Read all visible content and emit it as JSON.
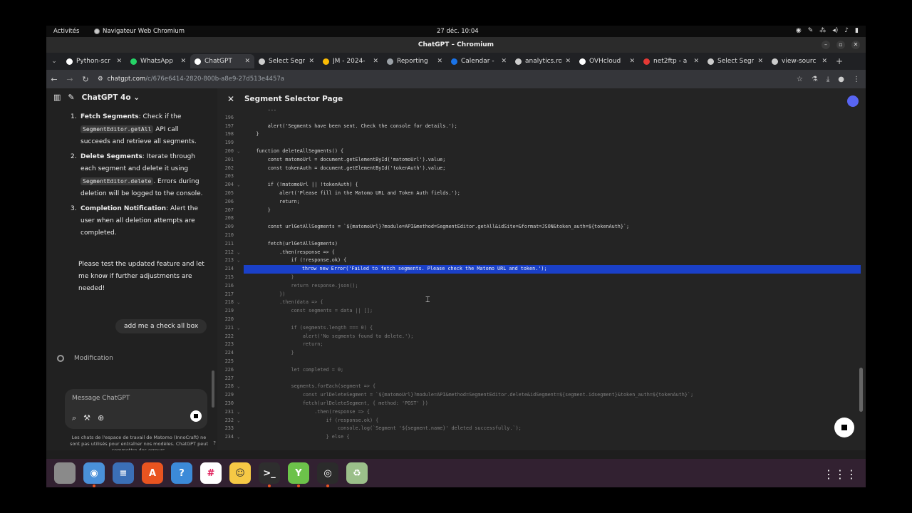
{
  "topbar": {
    "activities": "Activités",
    "app_name": "Navigateur Web Chromium",
    "clock": "27 déc.  10:04"
  },
  "window": {
    "title": "ChatGPT – Chromium"
  },
  "tabs": [
    {
      "label": "Python-scr",
      "color": "#ffffff"
    },
    {
      "label": "WhatsApp",
      "color": "#25d366"
    },
    {
      "label": "ChatGPT",
      "color": "#ffffff",
      "active": true
    },
    {
      "label": "Select Segn",
      "color": "#cccccc"
    },
    {
      "label": "JM - 2024-",
      "color": "#fbbc04"
    },
    {
      "label": "Reporting",
      "color": "#9aa0a6"
    },
    {
      "label": "Calendar - ",
      "color": "#1a73e8"
    },
    {
      "label": "analytics.ro",
      "color": "#cccccc"
    },
    {
      "label": "OVHcloud",
      "color": "#ffffff"
    },
    {
      "label": "net2ftp - a",
      "color": "#e53935"
    },
    {
      "label": "Select Segn",
      "color": "#cccccc"
    },
    {
      "label": "view-sourc",
      "color": "#cccccc"
    }
  ],
  "address": {
    "host": "chatgpt.com",
    "path": "/c/676e6414-2820-800b-a8e9-27d513e4457a"
  },
  "chat": {
    "model": "ChatGPT 4o",
    "steps": [
      {
        "num": "1.",
        "title": "Fetch Segments",
        "pre": ": Check if the ",
        "code": "SegmentEditor.getAll",
        "post": " API call succeeds and retrieve all segments."
      },
      {
        "num": "2.",
        "title": "Delete Segments",
        "pre": ": Iterate through each segment and delete it using ",
        "code": "SegmentEditor.delete",
        "post": ". Errors during deletion will be logged to the console."
      },
      {
        "num": "3.",
        "title": "Completion Notification",
        "pre": ": Alert the user when all deletion attempts are completed.",
        "code": "",
        "post": ""
      }
    ],
    "closing": "Please test the updated feature and let me know if further adjustments are needed!",
    "user_message": "add me a check all box",
    "status": "Modification",
    "composer_placeholder": "Message ChatGPT",
    "disclaimer": "Les chats de l'espace de travail de Matomo (InnoCraft) ne sont pas utilisés pour entraîner nos modèles. ChatGPT peut commettre des erreurs.",
    "help": "?"
  },
  "canvas": {
    "title": "Segment Selector Page",
    "highlight_line": "214",
    "lines": [
      {
        "n": "",
        "t": "        ..."
      },
      {
        "n": "196",
        "t": ""
      },
      {
        "n": "197",
        "t": "        alert('Segments have been sent. Check the console for details.');"
      },
      {
        "n": "198",
        "t": "    }"
      },
      {
        "n": "199",
        "t": ""
      },
      {
        "n": "200",
        "t": "    function deleteAllSegments() {",
        "fold": true
      },
      {
        "n": "201",
        "t": "        const matomoUrl = document.getElementById('matomoUrl').value;"
      },
      {
        "n": "202",
        "t": "        const tokenAuth = document.getElementById('tokenAuth').value;"
      },
      {
        "n": "203",
        "t": ""
      },
      {
        "n": "204",
        "t": "        if (!matomoUrl || !tokenAuth) {",
        "fold": true
      },
      {
        "n": "205",
        "t": "            alert('Please fill in the Matomo URL and Token Auth fields.');"
      },
      {
        "n": "206",
        "t": "            return;"
      },
      {
        "n": "207",
        "t": "        }"
      },
      {
        "n": "208",
        "t": ""
      },
      {
        "n": "209",
        "t": "        const urlGetAllSegments = `${matomoUrl}?module=API&method=SegmentEditor.getAll&idSite=&format=JSON&token_auth=${tokenAuth}`;"
      },
      {
        "n": "210",
        "t": ""
      },
      {
        "n": "211",
        "t": "        fetch(urlGetAllSegments)"
      },
      {
        "n": "212",
        "t": "            .then(response => {",
        "fold": true
      },
      {
        "n": "213",
        "t": "                if (!response.ok) {",
        "fold": true
      },
      {
        "n": "214",
        "t": "                    throw new Error('Failed to fetch segments. Please check the Matomo URL and token.');"
      },
      {
        "n": "215",
        "t": "                }",
        "dim": true
      },
      {
        "n": "216",
        "t": "                return response.json();",
        "dim": true
      },
      {
        "n": "217",
        "t": "            })",
        "dim": true
      },
      {
        "n": "218",
        "t": "            .then(data => {",
        "fold": true,
        "dim": true
      },
      {
        "n": "219",
        "t": "                const segments = data || [];",
        "dim": true
      },
      {
        "n": "220",
        "t": ""
      },
      {
        "n": "221",
        "t": "                if (segments.length === 0) {",
        "fold": true,
        "dim": true
      },
      {
        "n": "222",
        "t": "                    alert('No segments found to delete.');",
        "dim": true
      },
      {
        "n": "223",
        "t": "                    return;",
        "dim": true
      },
      {
        "n": "224",
        "t": "                }",
        "dim": true
      },
      {
        "n": "225",
        "t": ""
      },
      {
        "n": "226",
        "t": "                let completed = 0;",
        "dim": true
      },
      {
        "n": "227",
        "t": ""
      },
      {
        "n": "228",
        "t": "                segments.forEach(segment => {",
        "fold": true,
        "dim": true
      },
      {
        "n": "229",
        "t": "                    const urlDeleteSegment = `${matomoUrl}?module=API&method=SegmentEditor.delete&idSegment=${segment.idsegment}&token_auth=${tokenAuth}`;",
        "dim": true
      },
      {
        "n": "230",
        "t": "                    fetch(urlDeleteSegment, { method: 'POST' })",
        "dim": true
      },
      {
        "n": "231",
        "t": "                        .then(response => {",
        "fold": true,
        "dim": true
      },
      {
        "n": "232",
        "t": "                            if (response.ok) {",
        "fold": true,
        "dim": true
      },
      {
        "n": "233",
        "t": "                                console.log(`Segment '${segment.name}' deleted successfully.`);",
        "dim": true
      },
      {
        "n": "234",
        "t": "                            } else {",
        "fold": true,
        "dim": true
      }
    ]
  },
  "dock": [
    {
      "name": "files",
      "color": "#8a8a8a",
      "glyph": "",
      "running": false
    },
    {
      "name": "chromium",
      "color": "#4a90d9",
      "glyph": "◉",
      "running": true
    },
    {
      "name": "text-editor",
      "color": "#3b6fb6",
      "glyph": "≡",
      "running": false
    },
    {
      "name": "app-center",
      "color": "#e95420",
      "glyph": "A",
      "running": false
    },
    {
      "name": "help",
      "color": "#3c8ad8",
      "glyph": "?",
      "running": false
    },
    {
      "name": "slack",
      "color": "#ffffff",
      "glyph": "#",
      "running": false
    },
    {
      "name": "matomo-app",
      "color": "#f6c945",
      "glyph": "☺",
      "running": false
    },
    {
      "name": "terminal",
      "color": "#2e2e2e",
      "glyph": ">_",
      "running": true
    },
    {
      "name": "speedcrunch",
      "color": "#6cc24a",
      "glyph": "Y",
      "running": true
    },
    {
      "name": "obs",
      "color": "#2b2b2b",
      "glyph": "◎",
      "running": true
    },
    {
      "name": "trash",
      "color": "#9bbf8a",
      "glyph": "♻",
      "running": false
    }
  ]
}
